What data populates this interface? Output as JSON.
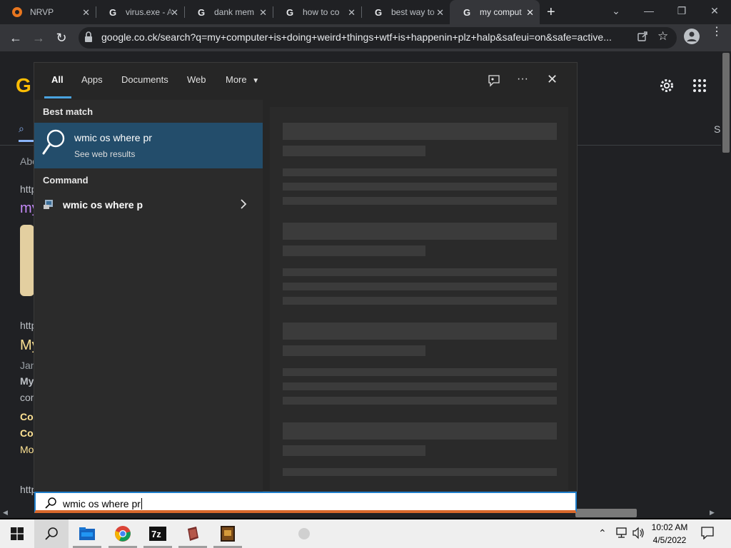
{
  "browser": {
    "tabs": [
      {
        "title": "NRVP",
        "favicon": "nrvp-icon"
      },
      {
        "title": "virus.exe - A",
        "favicon": "google-icon"
      },
      {
        "title": "dank mem",
        "favicon": "google-icon"
      },
      {
        "title": "how to co",
        "favicon": "google-icon"
      },
      {
        "title": "best way to",
        "favicon": "google-icon"
      },
      {
        "title": "my comput",
        "favicon": "google-icon",
        "active": true
      }
    ],
    "new_tab": "+",
    "url": "google.co.ck/search?q=my+computer+is+doing+weird+things+wtf+is+happenin+plz+halp&safeui=on&safe=active..."
  },
  "search_page": {
    "logo_letter": "G",
    "partial_texts": [
      "Abo",
      "http",
      "my",
      "http",
      "My",
      "Jan",
      "My",
      "com",
      "Cor",
      "Cor",
      "Mo",
      "http",
      "S"
    ]
  },
  "search_flyout": {
    "tabs": [
      {
        "label": "All",
        "active": true
      },
      {
        "label": "Apps"
      },
      {
        "label": "Documents"
      },
      {
        "label": "Web"
      },
      {
        "label": "More"
      }
    ],
    "best_match_heading": "Best match",
    "best_match": {
      "title": "wmic os where pr",
      "subtitle": "See web results"
    },
    "command_heading": "Command",
    "command_item": {
      "label": "wmic os where p"
    },
    "search_value": "wmic os where pr"
  },
  "taskbar": {
    "time": "10:02 AM",
    "date": "4/5/2022",
    "apps": [
      "windows-start",
      "search",
      "file-explorer",
      "chrome",
      "7zip",
      "app-book",
      "app-game"
    ]
  },
  "colors": {
    "accent": "#4aa3df",
    "best_match_bg": "#234d6b",
    "flyout_bg": "#262626"
  }
}
